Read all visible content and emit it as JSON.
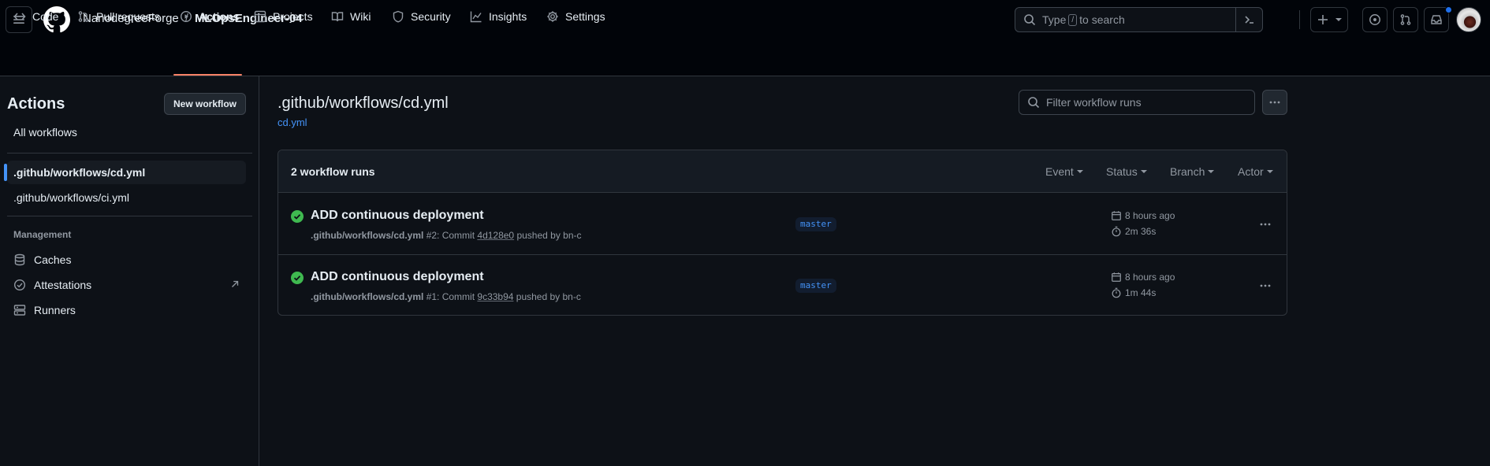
{
  "header": {
    "owner": "NanodegreeForge",
    "separator": "/",
    "repo": "MLOpsEngineer-04",
    "search_placeholder_pre": "Type",
    "search_key": "/",
    "search_placeholder_post": "to search"
  },
  "tabs": [
    {
      "label": "Code",
      "icon": "code-icon"
    },
    {
      "label": "Pull requests",
      "icon": "git-pull-request-icon"
    },
    {
      "label": "Actions",
      "icon": "play-icon",
      "active": true
    },
    {
      "label": "Projects",
      "icon": "table-icon"
    },
    {
      "label": "Wiki",
      "icon": "book-icon"
    },
    {
      "label": "Security",
      "icon": "shield-icon"
    },
    {
      "label": "Insights",
      "icon": "graph-icon"
    },
    {
      "label": "Settings",
      "icon": "gear-icon"
    }
  ],
  "sidebar": {
    "title": "Actions",
    "new_workflow": "New workflow",
    "all_workflows": "All workflows",
    "workflows": [
      ".github/workflows/cd.yml",
      ".github/workflows/ci.yml"
    ],
    "management_heading": "Management",
    "management": [
      {
        "label": "Caches",
        "icon": "database-icon"
      },
      {
        "label": "Attestations",
        "icon": "verified-icon"
      },
      {
        "label": "Runners",
        "icon": "server-icon"
      }
    ]
  },
  "main": {
    "title": ".github/workflows/cd.yml",
    "file_link": "cd.yml",
    "filter_placeholder": "Filter workflow runs",
    "runs_count": "2 workflow runs",
    "filters": [
      "Event",
      "Status",
      "Branch",
      "Actor"
    ],
    "runs": [
      {
        "title": "ADD continuous deployment",
        "workflow": ".github/workflows/cd.yml",
        "number": "#2",
        "commit_prefix": ": Commit",
        "sha": "4d128e0",
        "pushed_by": "pushed by bn-c",
        "branch": "master",
        "when": "8 hours ago",
        "duration": "2m 36s"
      },
      {
        "title": "ADD continuous deployment",
        "workflow": ".github/workflows/cd.yml",
        "number": "#1",
        "commit_prefix": ": Commit",
        "sha": "9c33b94",
        "pushed_by": "pushed by bn-c",
        "branch": "master",
        "when": "8 hours ago",
        "duration": "1m 44s"
      }
    ]
  },
  "colors": {
    "background": "#0d1117",
    "header": "#010409",
    "accent": "#4493f8",
    "tab_underline": "#f78166",
    "success": "#3fb950"
  }
}
